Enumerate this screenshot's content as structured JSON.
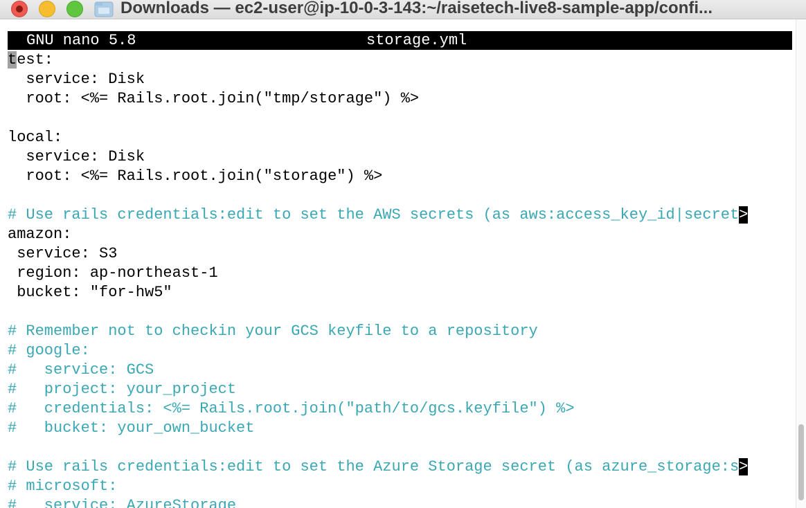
{
  "window": {
    "title": "Downloads — ec2-user@ip-10-0-3-143:~/raisetech-live8-sample-app/confi...",
    "folder_icon": "folder-icon"
  },
  "nano": {
    "version": "GNU nano 5.8",
    "filename": "storage.yml"
  },
  "editor": {
    "first_line_cursor_char": "t",
    "first_line_rest": "est:",
    "lines": [
      "  service: Disk",
      "  root: <%= Rails.root.join(\"tmp/storage\") %>",
      "",
      "local:",
      "  service: Disk",
      "  root: <%= Rails.root.join(\"storage\") %>",
      "",
      "# Use rails credentials:edit to set the AWS secrets (as aws:access_key_id|secret",
      "amazon:",
      " service: S3",
      " region: ap-northeast-1",
      " bucket: \"for-hw5\"",
      "",
      "# Remember not to checkin your GCS keyfile to a repository",
      "# google:",
      "#   service: GCS",
      "#   project: your_project",
      "#   credentials: <%= Rails.root.join(\"path/to/gcs.keyfile\") %>",
      "#   bucket: your_own_bucket",
      "",
      "# Use rails credentials:edit to set the Azure Storage secret (as azure_storage:s",
      "# microsoft:",
      "#   service: AzureStorage"
    ],
    "continuation_marker": ">",
    "colors": {
      "text": "#000000",
      "comment": "#3aa8b4",
      "header_bg": "#000000",
      "header_fg": "#ffffff"
    }
  }
}
